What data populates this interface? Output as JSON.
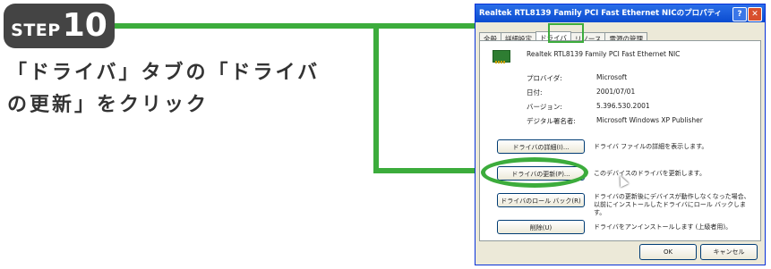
{
  "step": {
    "word": "STEP",
    "number": "10"
  },
  "instruction": {
    "line1": "「ドライバ」タブの「ドライバ",
    "line2": "の更新」をクリック"
  },
  "dialog": {
    "title": "Realtek RTL8139 Family PCI Fast Ethernet NICのプロパティ",
    "help": "?",
    "close": "✕",
    "tabs": [
      "全般",
      "詳細設定",
      "ドライバ",
      "リソース",
      "電源の管理"
    ],
    "active_tab": "ドライバ",
    "device_name": "Realtek RTL8139 Family PCI Fast Ethernet NIC",
    "info": [
      {
        "label": "プロバイダ:",
        "value": "Microsoft"
      },
      {
        "label": "日付:",
        "value": "2001/07/01"
      },
      {
        "label": "バージョン:",
        "value": "5.396.530.2001"
      },
      {
        "label": "デジタル署名者:",
        "value": "Microsoft Windows XP Publisher"
      }
    ],
    "buttons": [
      {
        "label": "ドライバの詳細(I)...",
        "desc": "ドライバ ファイルの詳細を表示します。"
      },
      {
        "label": "ドライバの更新(P)...",
        "desc": "このデバイスのドライバを更新します。"
      },
      {
        "label": "ドライバのロール バック(R)",
        "desc": "ドライバの更新後にデバイスが動作しなくなった場合、以前にインストールしたドライバにロール バックします。"
      },
      {
        "label": "削除(U)",
        "desc": "ドライバをアンインストールします (上級者用)。"
      }
    ],
    "ok": "OK",
    "cancel": "キャンセル"
  },
  "colors": {
    "highlight": "#3cac3c",
    "badge": "#444444"
  }
}
